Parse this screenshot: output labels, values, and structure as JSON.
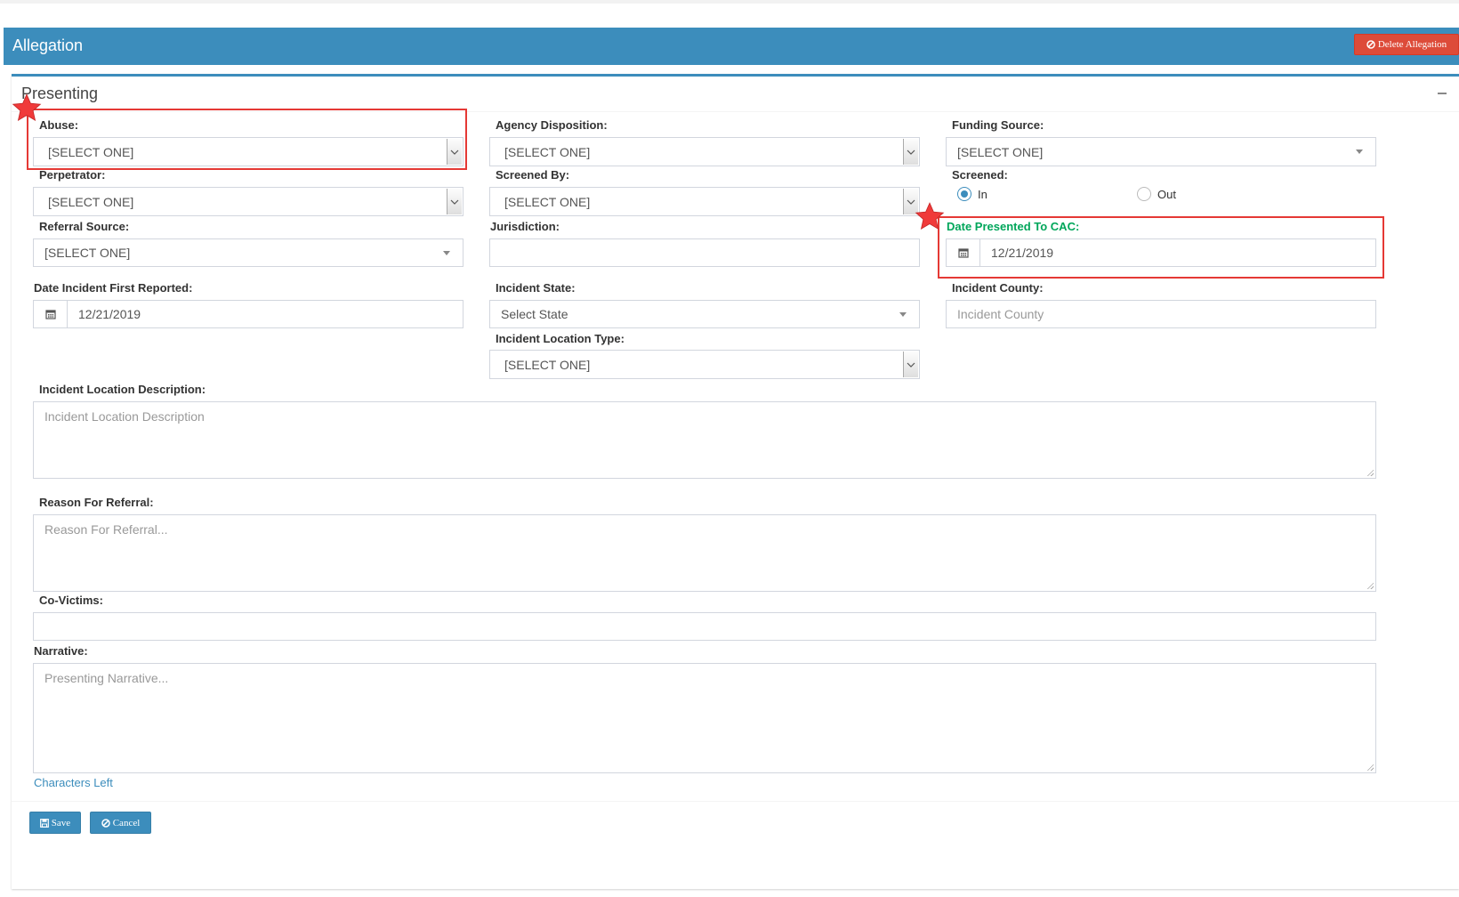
{
  "header": {
    "title": "Allegation",
    "delete_label": "Delete Allegation"
  },
  "panel": {
    "title": "Presenting"
  },
  "fields": {
    "abuse": {
      "label": "Abuse:",
      "value": "[SELECT ONE]"
    },
    "agency_disposition": {
      "label": "Agency Disposition:",
      "value": "[SELECT ONE]"
    },
    "funding_source": {
      "label": "Funding Source:",
      "value": "[SELECT ONE]"
    },
    "perpetrator": {
      "label": "Perpetrator:",
      "value": "[SELECT ONE]"
    },
    "screened_by": {
      "label": "Screened By:",
      "value": "[SELECT ONE]"
    },
    "screened": {
      "label": "Screened:",
      "options": [
        "In",
        "Out"
      ],
      "selected": "In"
    },
    "referral_source": {
      "label": "Referral Source:",
      "value": "[SELECT ONE]"
    },
    "jurisdiction": {
      "label": "Jurisdiction:",
      "value": ""
    },
    "date_presented": {
      "label": "Date Presented To CAC:",
      "value": "12/21/2019"
    },
    "date_first_reported": {
      "label": "Date Incident First Reported:",
      "value": "12/21/2019"
    },
    "incident_state": {
      "label": "Incident State:",
      "value": "Select State"
    },
    "incident_county": {
      "label": "Incident County:",
      "placeholder": "Incident County"
    },
    "incident_location_type": {
      "label": "Incident Location Type:",
      "value": "[SELECT ONE]"
    },
    "incident_location_description": {
      "label": "Incident Location Description:",
      "placeholder": "Incident Location Description"
    },
    "reason_for_referral": {
      "label": "Reason For Referral:",
      "placeholder": "Reason For Referral..."
    },
    "co_victims": {
      "label": "Co-Victims:",
      "value": ""
    },
    "narrative": {
      "label": "Narrative:",
      "placeholder": "Presenting Narrative...",
      "chars_left_label": "Characters Left"
    }
  },
  "footer": {
    "save_label": "Save",
    "cancel_label": "Cancel"
  },
  "colors": {
    "primary": "#3c8dbc",
    "danger": "#dd4b39",
    "success": "#00a65a",
    "highlight": "#e53935"
  },
  "icons": [
    "ban-icon",
    "minus-icon",
    "chevron-down-icon",
    "caret-down-icon",
    "calendar-icon",
    "floppy-disk-icon",
    "star-icon",
    "resize-grip-icon"
  ]
}
